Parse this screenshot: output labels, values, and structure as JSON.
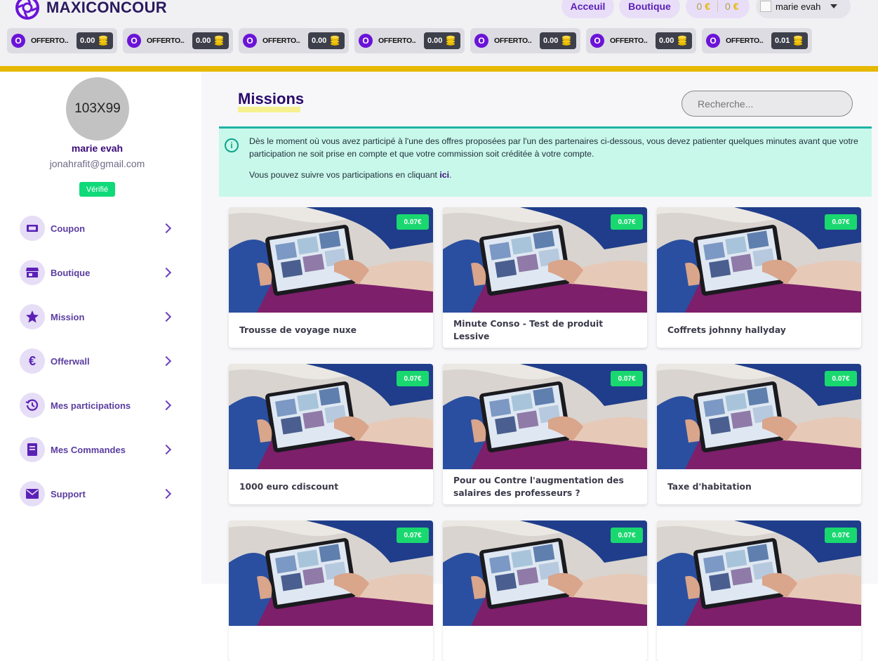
{
  "brand": {
    "name": "MAXICONCOUR"
  },
  "nav": {
    "home": "Acceuil",
    "shop": "Boutique"
  },
  "balance": {
    "value1": "0",
    "currency1": "€",
    "value2": "0",
    "currency2": "€"
  },
  "user_menu": {
    "name": "marie evah"
  },
  "offerwalls": [
    {
      "badge": "O",
      "name": "OFFERTO...",
      "value": "0.00"
    },
    {
      "badge": "O",
      "name": "OFFERTO...",
      "value": "0.00"
    },
    {
      "badge": "O",
      "name": "OFFERTO...",
      "value": "0.00"
    },
    {
      "badge": "O",
      "name": "OFFERTO...",
      "value": "0.00"
    },
    {
      "badge": "O",
      "name": "OFFERTO...",
      "value": "0.00"
    },
    {
      "badge": "O",
      "name": "OFFERTO...",
      "value": "0.00"
    },
    {
      "badge": "O",
      "name": "OFFERTO...",
      "value": "0.01"
    }
  ],
  "profile": {
    "avatar_placeholder": "103X99",
    "name": "marie evah",
    "email": "jonahrafit@gmail.com",
    "status": "Vérifié"
  },
  "sidebar": {
    "items": [
      {
        "label": "Coupon",
        "icon": "ticket-icon"
      },
      {
        "label": "Boutique",
        "icon": "store-icon"
      },
      {
        "label": "Mission",
        "icon": "star-icon"
      },
      {
        "label": "Offerwall",
        "icon": "euro-icon"
      },
      {
        "label": "Mes participations",
        "icon": "history-icon"
      },
      {
        "label": "Mes Commandes",
        "icon": "book-icon"
      },
      {
        "label": "Support",
        "icon": "envelope-icon"
      }
    ]
  },
  "main": {
    "title": "Missions",
    "search_placeholder": "Recherche...",
    "alert": {
      "text": "Dès le moment où vous avez participé à l'une des offres proposées par l'un des partenaires ci-dessous, vous devez patienter quelques minutes avant que votre participation ne soit prise en compte et que votre commission soit créditée à votre compte.",
      "follow_text": "Vous pouvez suivre vos participations en cliquant",
      "link": "ici",
      "suffix": "."
    },
    "missions": [
      {
        "title": "Trousse de voyage nuxe",
        "reward": "0.07€"
      },
      {
        "title": "Minute Conso - Test de produit Lessive",
        "reward": "0.07€"
      },
      {
        "title": "Coffrets johnny hallyday",
        "reward": "0.07€"
      },
      {
        "title": "1000 euro cdiscount",
        "reward": "0.07€"
      },
      {
        "title": "Pour ou Contre l'augmentation des salaires des professeurs ?",
        "reward": "0.07€"
      },
      {
        "title": "Taxe d'habitation",
        "reward": "0.07€"
      },
      {
        "title": "",
        "reward": "0.07€"
      },
      {
        "title": "",
        "reward": "0.07€"
      },
      {
        "title": "",
        "reward": "0.07€"
      }
    ]
  },
  "colors": {
    "brand": "#5b21b6",
    "accent": "#e6b800",
    "success": "#19d86f",
    "alert_bg": "#c8f8ea"
  }
}
